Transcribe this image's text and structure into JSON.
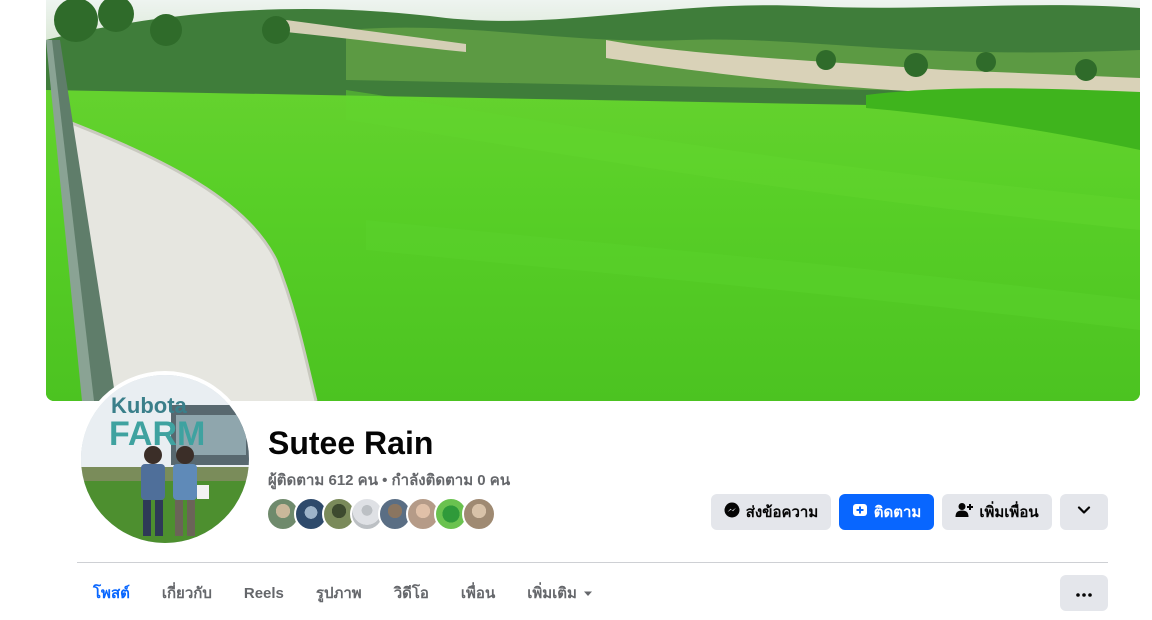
{
  "profile": {
    "name": "Sutee Rain",
    "stats": "ผู้ติดตาม 612 คน • กำลังติดตาม 0 คน",
    "avatar_sign_text": [
      "Kubota",
      "FARM"
    ]
  },
  "actions": {
    "message_label": "ส่งข้อความ",
    "follow_label": "ติดตาม",
    "add_friend_label": "เพิ่มเพื่อน"
  },
  "tabs": [
    {
      "label": "โพสต์",
      "active": true
    },
    {
      "label": "เกี่ยวกับ",
      "active": false
    },
    {
      "label": "Reels",
      "active": false
    },
    {
      "label": "รูปภาพ",
      "active": false
    },
    {
      "label": "วิดีโอ",
      "active": false
    },
    {
      "label": "เพื่อน",
      "active": false
    },
    {
      "label": "เพิ่มเติม",
      "active": false
    }
  ],
  "colors": {
    "accent": "#0866ff",
    "button_gray": "#e4e6eb",
    "secondary_text": "#65676b"
  },
  "icons": [
    "messenger-icon",
    "follow-icon",
    "add-friend-icon",
    "chevron-down-icon",
    "caret-down-icon",
    "more-dots-icon"
  ]
}
